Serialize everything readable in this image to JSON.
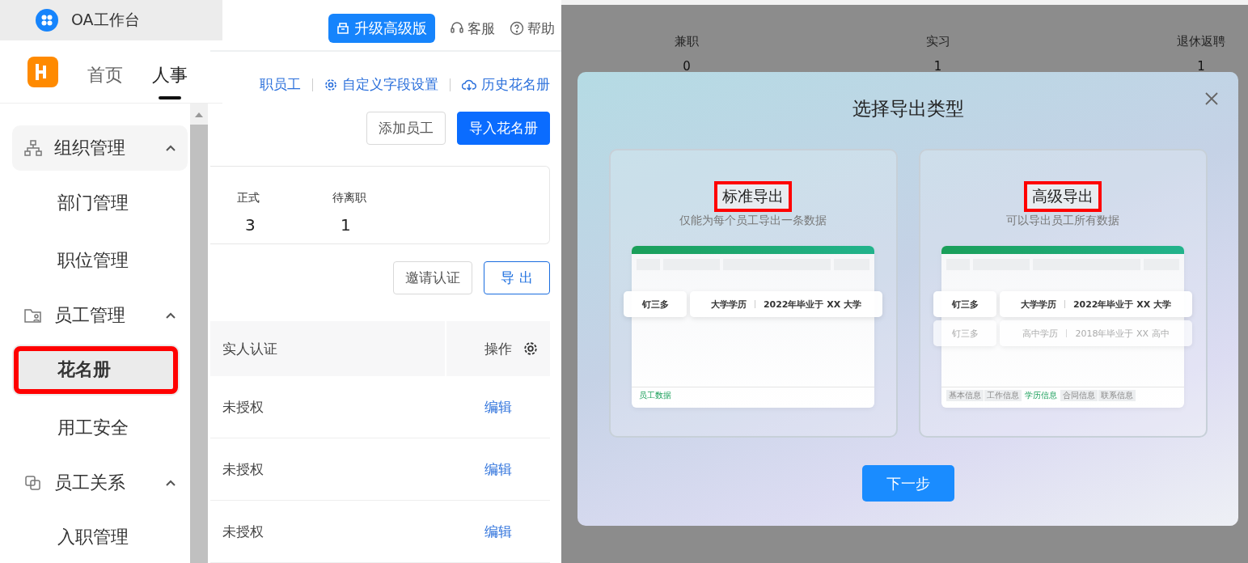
{
  "app_tab": {
    "title": "OA工作台"
  },
  "top_nav": [
    {
      "label": "首页",
      "selected": false
    },
    {
      "label": "人事",
      "selected": true
    }
  ],
  "sidebar": {
    "items": [
      {
        "label": "组织管理",
        "expanded": true,
        "children": [
          {
            "label": "部门管理",
            "selected": false,
            "highlighted": false
          },
          {
            "label": "职位管理",
            "selected": false,
            "highlighted": false
          }
        ]
      },
      {
        "label": "员工管理",
        "expanded": true,
        "children": [
          {
            "label": "花名册",
            "selected": true,
            "highlighted": true
          },
          {
            "label": "用工安全",
            "selected": false,
            "highlighted": false
          }
        ]
      },
      {
        "label": "员工关系",
        "expanded": true,
        "children": [
          {
            "label": "入职管理",
            "selected": false,
            "highlighted": false
          }
        ]
      }
    ]
  },
  "header": {
    "upgrade_button": "升级高级版",
    "links": [
      {
        "label": "客服"
      },
      {
        "label": "帮助"
      }
    ]
  },
  "toolbar_links": [
    {
      "label": "职员工"
    },
    {
      "label": "自定义字段设置"
    },
    {
      "label": "历史花名册"
    }
  ],
  "actions": [
    {
      "label": "添加员工",
      "primary": false
    },
    {
      "label": "导入花名册",
      "primary": true
    }
  ],
  "stats": [
    {
      "label": "正式",
      "value": "3"
    },
    {
      "label": "待离职",
      "value": "1"
    }
  ],
  "table_actions": [
    {
      "label": "邀请认证",
      "kind": "default"
    },
    {
      "label": "导 出",
      "kind": "outline"
    }
  ],
  "table": {
    "columns": [
      "实人认证",
      "操作"
    ],
    "rows": [
      [
        "未授权",
        "编辑"
      ],
      [
        "未授权",
        "编辑"
      ],
      [
        "未授权",
        "编辑"
      ]
    ]
  },
  "background_stats": [
    {
      "label": "兼职",
      "value": "0"
    },
    {
      "label": "实习",
      "value": "1"
    },
    {
      "label": "退休返聘",
      "value": "1"
    }
  ],
  "dialog": {
    "title": "选择导出类型",
    "options": [
      {
        "title": "标准导出",
        "subtitle": "仅能为每个员工导出一条数据",
        "highlighted": true,
        "rows": [
          {
            "name": "钉三多",
            "degree": "大学学历",
            "graduation": "2022年毕业于 XX 大学",
            "dim": false
          }
        ],
        "sheet_tabs": [
          {
            "label": "员工数据",
            "selected": true
          }
        ]
      },
      {
        "title": "高级导出",
        "subtitle": "可以导出员工所有数据",
        "highlighted": true,
        "rows": [
          {
            "name": "钉三多",
            "degree": "大学学历",
            "graduation": "2022年毕业于 XX 大学",
            "dim": false
          },
          {
            "name": "钉三多",
            "degree": "高中学历",
            "graduation": "2018年毕业于 XX 高中",
            "dim": true
          }
        ],
        "sheet_tabs": [
          {
            "label": "基本信息",
            "selected": false
          },
          {
            "label": "工作信息",
            "selected": false
          },
          {
            "label": "学历信息",
            "selected": true
          },
          {
            "label": "合同信息",
            "selected": false
          },
          {
            "label": "联系信息",
            "selected": false
          }
        ]
      }
    ],
    "next_button": "下一步"
  }
}
